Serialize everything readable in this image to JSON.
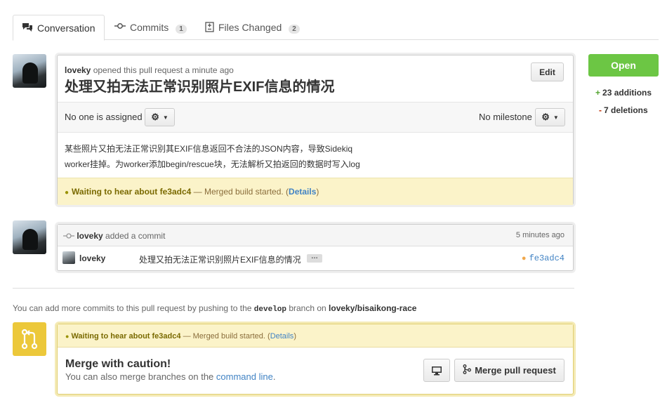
{
  "tabs": [
    {
      "label": "Conversation",
      "icon": "speech-bubbles-icon"
    },
    {
      "label": "Commits",
      "icon": "commit-icon",
      "count": "1"
    },
    {
      "label": "Files Changed",
      "icon": "file-diff-icon",
      "count": "2"
    }
  ],
  "pull_request": {
    "author": "loveky",
    "opened_text": "opened this pull request a minute ago",
    "title": "处理又拍无法正常识别照片EXIF信息的情况",
    "edit_label": "Edit",
    "assignee_text": "No one is assigned",
    "milestone_text": "No milestone",
    "body_line1": "某些照片又拍无法正常识别其EXIF信息返回不合法的JSON内容，导致Sidekiq",
    "body_line2": "worker挂掉。为worker添加begin/rescue块，无法解析又拍返回的数据时写入log",
    "build_status": "Waiting to hear about fe3adc4",
    "build_dash": "— Merged build started. (",
    "build_details": "Details",
    "build_close": ")"
  },
  "commit_event": {
    "author": "loveky",
    "action": "added a commit",
    "time": "5 minutes ago",
    "commit_author": "loveky",
    "commit_message": "处理又拍无法正常识别照片EXIF信息的情况",
    "ellipsis": "…",
    "sha": "fe3adc4"
  },
  "push_info": {
    "prefix": "You can add more commits to this pull request by pushing to the",
    "branch": "develop",
    "middle": "branch on",
    "repo": "loveky/bisaikong-race"
  },
  "merge": {
    "status": "Waiting to hear about fe3adc4",
    "status_dash": "— Merged build started. (",
    "details": "Details",
    "close": ")",
    "title": "Merge with caution!",
    "sub_prefix": "You can also merge branches on the",
    "command_line": "command line",
    "sub_suffix": ".",
    "merge_button": "Merge pull request"
  },
  "sidebar": {
    "state": "Open",
    "additions": "23 additions",
    "deletions": "7 deletions"
  },
  "colors": {
    "open_green": "#6cc644",
    "pending_yellow": "#fbf3c9",
    "link_blue": "#4183c4"
  }
}
